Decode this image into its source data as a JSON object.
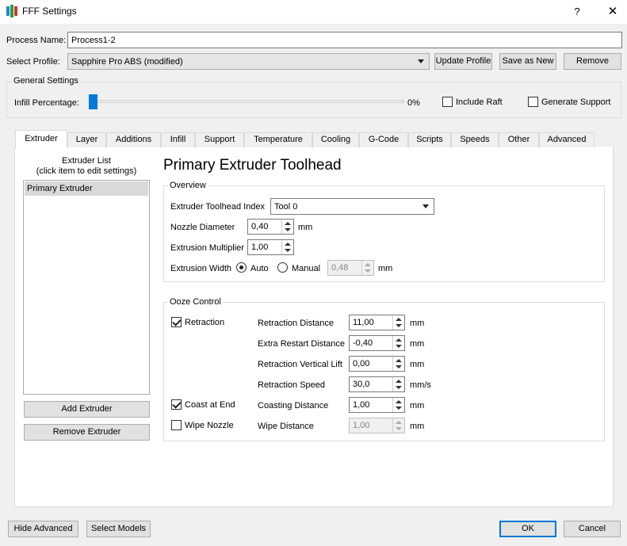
{
  "window": {
    "title": "FFF Settings",
    "help_glyph": "?",
    "close_glyph": "✕"
  },
  "header": {
    "process_name_label": "Process Name:",
    "process_name_value": "Process1-2",
    "select_profile_label": "Select Profile:",
    "profile_value": "Sapphire Pro ABS (modified)",
    "update_profile": "Update Profile",
    "save_as_new": "Save as New",
    "remove": "Remove"
  },
  "general": {
    "title": "General Settings",
    "infill_label": "Infill Percentage:",
    "infill_value": "0%",
    "infill_fraction": 0.0,
    "include_raft": "Include Raft",
    "generate_support": "Generate Support"
  },
  "tabs": [
    {
      "label": "Extruder",
      "active": true
    },
    {
      "label": "Layer"
    },
    {
      "label": "Additions"
    },
    {
      "label": "Infill"
    },
    {
      "label": "Support"
    },
    {
      "label": "Temperature"
    },
    {
      "label": "Cooling"
    },
    {
      "label": "G-Code"
    },
    {
      "label": "Scripts"
    },
    {
      "label": "Speeds"
    },
    {
      "label": "Other"
    },
    {
      "label": "Advanced"
    }
  ],
  "extruder": {
    "list_title_line1": "Extruder List",
    "list_title_line2": "(click item to edit settings)",
    "items": [
      "Primary Extruder"
    ],
    "add_button": "Add Extruder",
    "remove_button": "Remove Extruder",
    "heading": "Primary Extruder Toolhead",
    "overview": {
      "title": "Overview",
      "toolhead_index_label": "Extruder Toolhead Index",
      "toolhead_index_value": "Tool 0",
      "nozzle_diameter_label": "Nozzle Diameter",
      "nozzle_diameter_value": "0,40",
      "nozzle_diameter_unit": "mm",
      "extrusion_multiplier_label": "Extrusion Multiplier",
      "extrusion_multiplier_value": "1,00",
      "extrusion_width_label": "Extrusion Width",
      "auto_label": "Auto",
      "manual_label": "Manual",
      "extrusion_width_value": "0,48",
      "extrusion_width_unit": "mm"
    },
    "ooze": {
      "title": "Ooze Control",
      "retraction": "Retraction",
      "coast_at_end": "Coast at End",
      "wipe_nozzle": "Wipe Nozzle",
      "retraction_distance_label": "Retraction Distance",
      "retraction_distance_value": "11,00",
      "extra_restart_label": "Extra Restart Distance",
      "extra_restart_value": "-0,40",
      "vertical_lift_label": "Retraction Vertical Lift",
      "vertical_lift_value": "0,00",
      "retraction_speed_label": "Retraction Speed",
      "retraction_speed_value": "30,0",
      "coasting_distance_label": "Coasting Distance",
      "coasting_distance_value": "1,00",
      "wipe_distance_label": "Wipe Distance",
      "wipe_distance_value": "1,00",
      "unit_mm": "mm",
      "unit_mms": "mm/s"
    }
  },
  "footer": {
    "hide_advanced": "Hide Advanced",
    "select_models": "Select Models",
    "ok": "OK",
    "cancel": "Cancel"
  }
}
